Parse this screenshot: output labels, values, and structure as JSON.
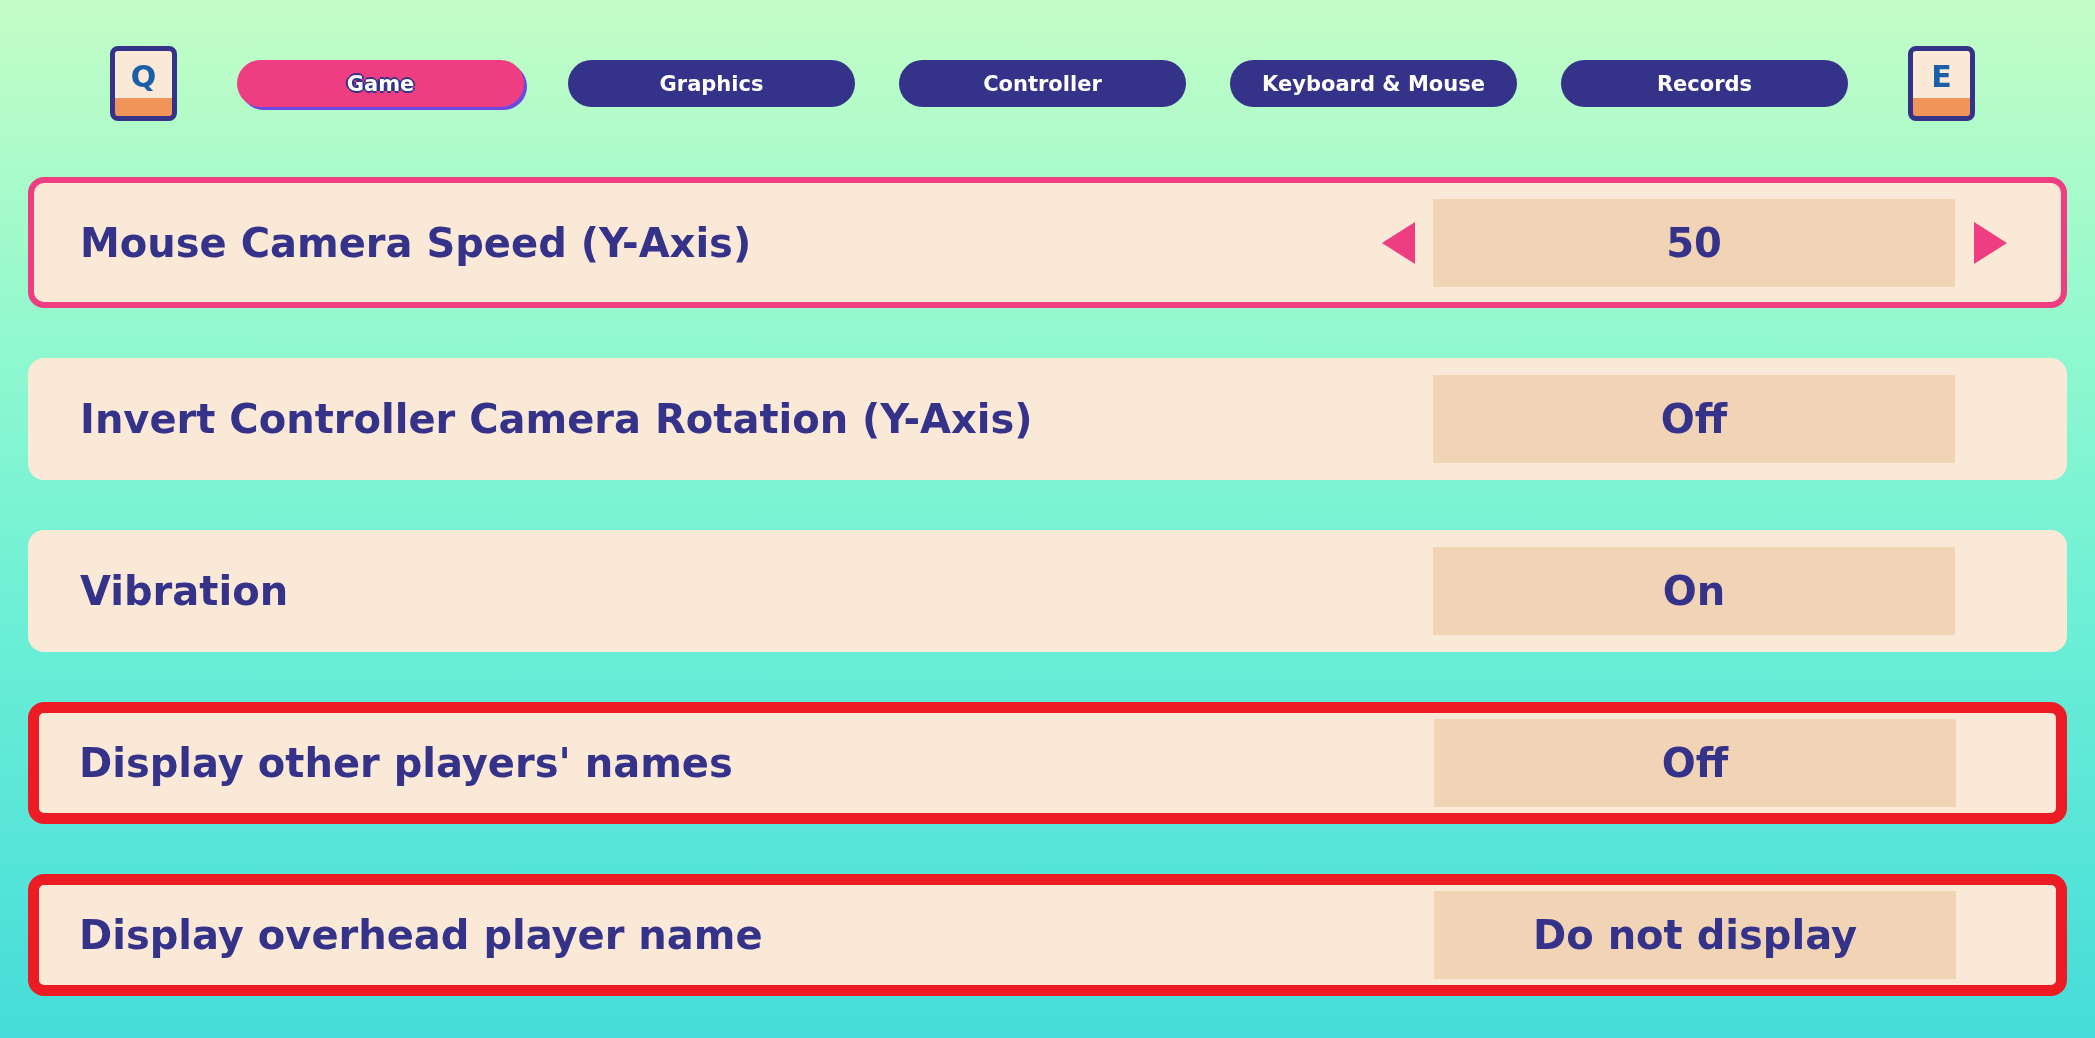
{
  "tab_bar": {
    "prev_key": "Q",
    "next_key": "E",
    "tabs": [
      {
        "label": "Game",
        "selected": true
      },
      {
        "label": "Graphics",
        "selected": false
      },
      {
        "label": "Controller",
        "selected": false
      },
      {
        "label": "Keyboard & Mouse",
        "selected": false
      },
      {
        "label": "Records",
        "selected": false
      }
    ]
  },
  "settings": [
    {
      "label": "Mouse Camera Speed (Y-Axis)",
      "value": "50",
      "selected": true,
      "flagged": false
    },
    {
      "label": "Invert Controller Camera Rotation (Y-Axis)",
      "value": "Off",
      "selected": false,
      "flagged": false
    },
    {
      "label": "Vibration",
      "value": "On",
      "selected": false,
      "flagged": false
    },
    {
      "label": "Display other players' names",
      "value": "Off",
      "selected": false,
      "flagged": true
    },
    {
      "label": "Display overhead player name",
      "value": "Do not display",
      "selected": false,
      "flagged": true
    }
  ]
}
